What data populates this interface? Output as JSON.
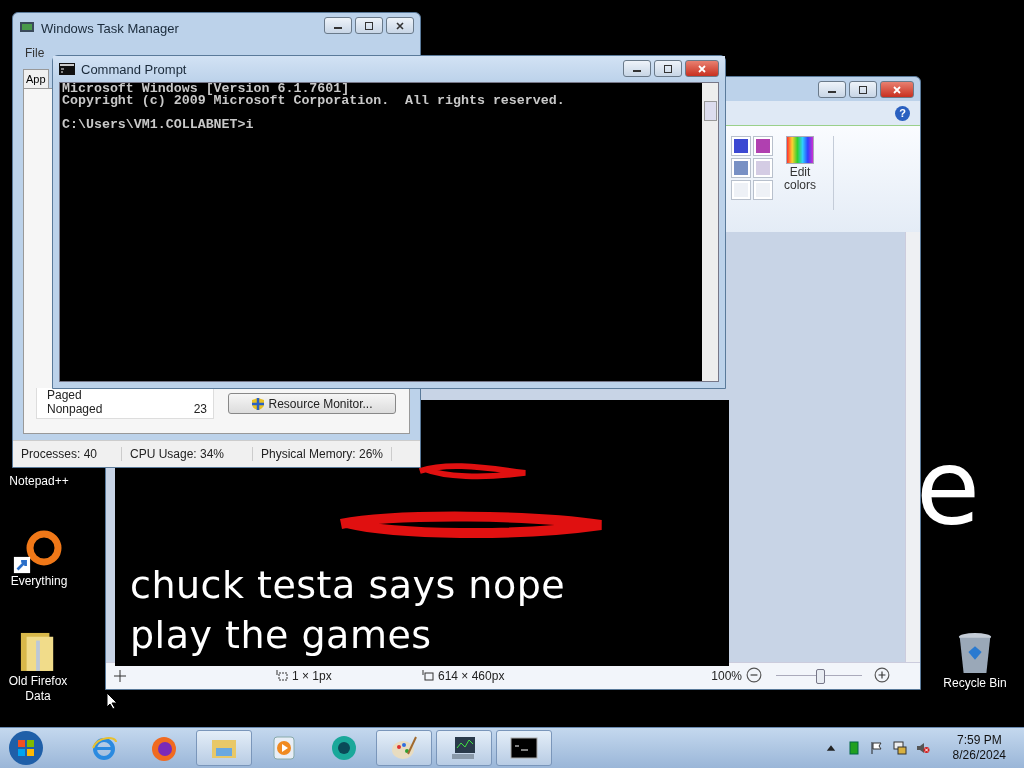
{
  "desktop": {
    "wallpaper_texts": [
      {
        "text": "e",
        "kind": "right"
      }
    ],
    "icons": [
      {
        "label": "Notepad++",
        "kind": "plain"
      },
      {
        "label": "Everything",
        "kind": "shortcut"
      },
      {
        "label": "Old Firefox Data",
        "kind": "folder"
      },
      {
        "label": "Recycle Bin",
        "kind": "bin"
      }
    ]
  },
  "task_manager": {
    "title": "Windows Task Manager",
    "menu": [
      "File"
    ],
    "tab": "App",
    "memory": [
      {
        "label": "Paged"
      },
      {
        "label": "Nonpaged",
        "value": "23"
      }
    ],
    "button": "Resource Monitor...",
    "status": [
      "Processes: 40",
      "CPU Usage: 34%",
      "Physical Memory: 26%"
    ]
  },
  "paint": {
    "colors": [
      {
        "color": "#3b48d2"
      },
      {
        "color": "#b040b0"
      },
      {
        "color": "#7890c4"
      },
      {
        "color": "#d4cce4"
      },
      {
        "color": "#eef1f6"
      },
      {
        "color": "#eef1f6"
      }
    ],
    "help": "?",
    "edit_colors": "Edit colors",
    "canvas_lines": [
      "chuck testa says nope",
      "play the games"
    ],
    "status": {
      "selection": "1 × 1px",
      "size": "614 × 460px",
      "zoom": "100%"
    },
    "zoom_slider": {
      "level": 0.5
    }
  },
  "command_prompt": {
    "title": "Command Prompt",
    "output": [
      "Microsoft Windows [Version 6.1.7601]",
      "Copyright (c) 2009 Microsoft Corporation.  All rights reserved."
    ],
    "prompt": "C:\\Users\\VM1.COLLABNET>i"
  },
  "taskbar": {
    "items": [
      {
        "kind": "ie",
        "running": false
      },
      {
        "kind": "firefox",
        "running": false
      },
      {
        "kind": "explorer",
        "running": true
      },
      {
        "kind": "media",
        "running": false
      },
      {
        "kind": "app",
        "running": false
      },
      {
        "kind": "paint",
        "running": true
      },
      {
        "kind": "taskmgr",
        "running": true
      },
      {
        "kind": "cmd",
        "running": true
      }
    ],
    "clock": {
      "time": "7:59 PM",
      "date": "8/26/2024"
    }
  }
}
